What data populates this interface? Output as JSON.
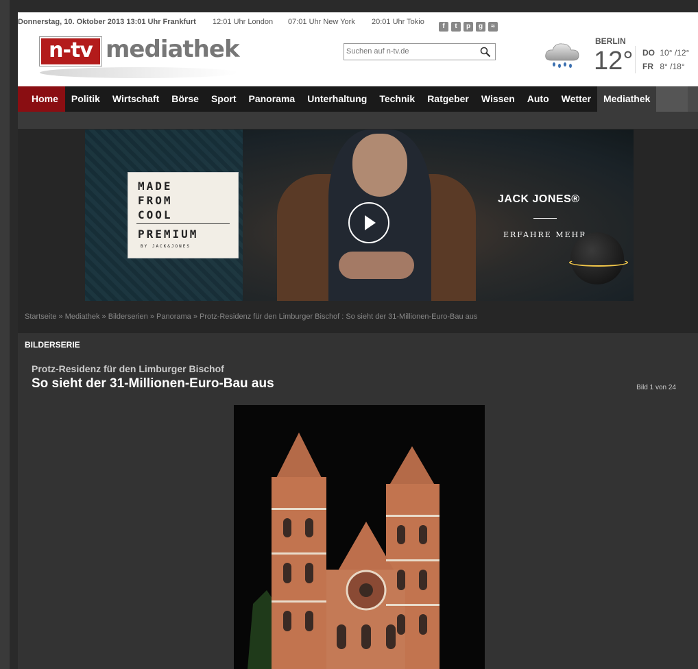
{
  "topbar": {
    "date": "Donnerstag, 10. Oktober 2013 13:01 Uhr Frankfurt",
    "times": [
      "12:01 Uhr London",
      "07:01 Uhr New York",
      "20:01 Uhr Tokio"
    ],
    "social_icons": [
      "facebook-icon",
      "twitter-icon",
      "pinterest-icon",
      "googleplus-icon",
      "rss-icon"
    ]
  },
  "logo": {
    "brand": "n-tv",
    "section": "mediathek"
  },
  "search": {
    "placeholder": "Suchen auf n-tv.de"
  },
  "weather": {
    "city": "BERLIN",
    "temp": "12°",
    "icon": "rain-cloud-icon",
    "days": [
      {
        "day": "DO",
        "range": "10° /12°"
      },
      {
        "day": "FR",
        "range": "8° /18°"
      }
    ]
  },
  "nav": {
    "items": [
      "Home",
      "Politik",
      "Wirtschaft",
      "Börse",
      "Sport",
      "Panorama",
      "Unterhaltung",
      "Technik",
      "Ratgeber",
      "Wissen",
      "Auto",
      "Wetter",
      "Mediathek"
    ],
    "active": "Mediathek"
  },
  "ad": {
    "label_lines": [
      "MADE",
      "FROM",
      "COOL",
      "PREMIUM"
    ],
    "label_sub": "BY JACK&JONES",
    "brand": "JACK JONES®",
    "cta": "ERFAHRE MEHR ▸"
  },
  "breadcrumb": {
    "items": [
      "Startseite",
      "Mediathek",
      "Bilderserien",
      "Panorama",
      "Protz-Residenz für den Limburger Bischof : So sieht der 31-Millionen-Euro-Bau aus"
    ],
    "separator": " » "
  },
  "gallery": {
    "section_label": "BILDERSERIE",
    "kicker": "Protz-Residenz für den Limburger Bischof",
    "headline": "So sieht der 31-Millionen-Euro-Bau aus",
    "counter": "Bild 1 von 24"
  },
  "colors": {
    "brand_red": "#b31b1b",
    "home_tab": "#8a0e12",
    "nav_bg": "#1a1a1a"
  }
}
